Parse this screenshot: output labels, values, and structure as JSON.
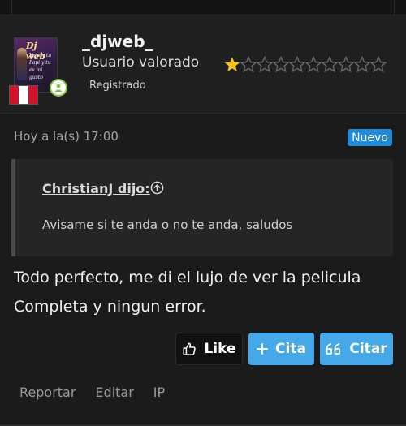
{
  "user": {
    "avatar_text": "Dj web",
    "avatar_lines": [
      "Ye soy tu",
      "Papi y tu",
      "es mi gusto"
    ],
    "username": "_djweb_",
    "title": "Usuario valorado",
    "status": "Registrado",
    "rating_filled": 1,
    "rating_total": 10,
    "colors": {
      "star_filled": "#f5c518",
      "star_empty": "#6e6e6e",
      "verified_ring": "#7fc242"
    }
  },
  "post": {
    "timestamp": "Hoy a la(s) 17:00",
    "badge": "Nuevo",
    "quote": {
      "author": "ChristianJ dijo:",
      "text": "Avisame si te anda o no te anda, saludos"
    },
    "message_lines": [
      "Todo perfecto, me di el lujo de ver la pelicula",
      "Completa y ningun error."
    ]
  },
  "buttons": {
    "like": "Like",
    "cita": "Cita",
    "citar": "Citar",
    "like_icon": "thumbs-up-icon",
    "cita_icon": "plus-icon",
    "citar_icon": "quote-icon",
    "accent": "#45a8e8"
  },
  "actions": {
    "report": "Reportar",
    "edit": "Editar",
    "ip": "IP"
  }
}
